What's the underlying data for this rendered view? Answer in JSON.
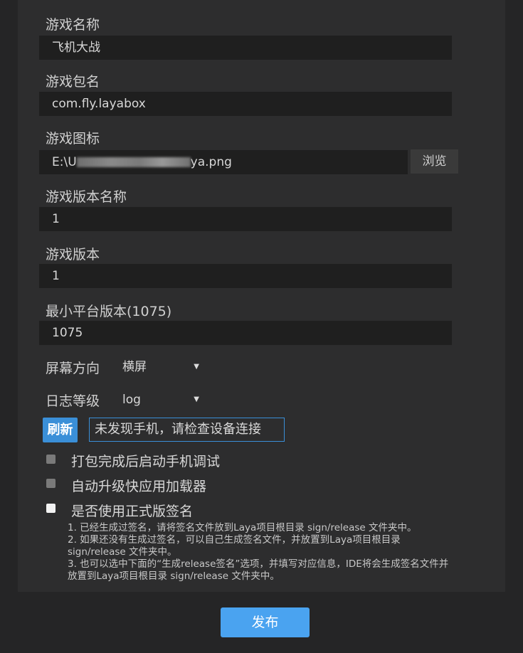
{
  "form": {
    "game_name_label": "游戏名称",
    "game_name_value": "飞机大战",
    "package_label": "游戏包名",
    "package_value": "com.fly.layabox",
    "icon_label": "游戏图标",
    "icon_value_prefix": "E:\\U",
    "icon_value_suffix": "ya.png",
    "browse_label": "浏览",
    "version_name_label": "游戏版本名称",
    "version_name_value": "1",
    "version_label": "游戏版本",
    "version_value": "1",
    "min_platform_label": "最小平台版本(1075)",
    "min_platform_value": "1075",
    "orientation_label": "屏幕方向",
    "orientation_value": "横屏",
    "log_level_label": "日志等级",
    "log_level_value": "log"
  },
  "device": {
    "refresh_label": "刷新",
    "status_text": "未发现手机，请检查设备连接"
  },
  "options": [
    {
      "label": "打包完成后启动手机调试",
      "checked": false
    },
    {
      "label": "自动升级快应用加载器",
      "checked": false
    },
    {
      "label": "是否使用正式版签名",
      "checked": false
    }
  ],
  "notes": [
    "1. 已经生成过签名，请将签名文件放到Laya项目根目录 sign/release 文件夹中。",
    "2. 如果还没有生成过签名，可以自己生成签名文件，并放置到Laya项目根目录",
    "sign/release 文件夹中。",
    "3. 也可以选中下面的“生成release签名”选项，并填写对应信息，IDE将会生成签名文件并",
    "放置到Laya项目根目录 sign/release 文件夹中。"
  ],
  "footer": {
    "publish_label": "发布"
  }
}
